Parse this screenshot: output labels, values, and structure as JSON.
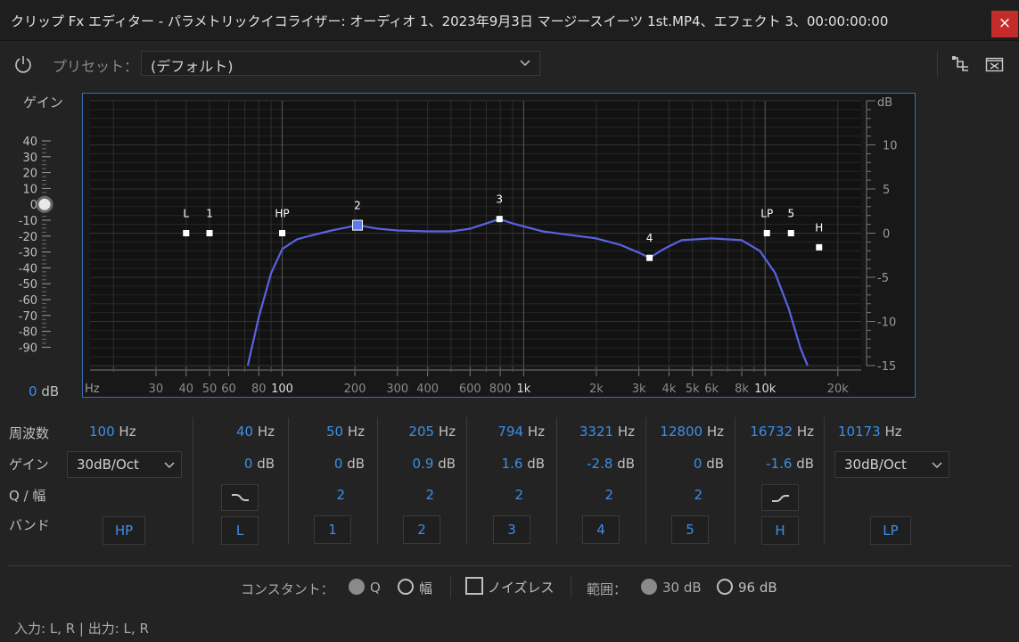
{
  "window": {
    "title": "クリップ Fx エディター - パラメトリックイコライザー: オーディオ 1、2023年9月3日 マージースイーツ 1st.MP4、エフェクト 3、00:00:00:00",
    "close_glyph": "×"
  },
  "toolbar": {
    "preset_label": "プリセット：",
    "preset_value": "(デフォルト)"
  },
  "gain_slider": {
    "label": "ゲイン",
    "ticks": [
      "40",
      "30",
      "20",
      "10",
      "0",
      "-10",
      "-20",
      "-30",
      "-40",
      "-50",
      "-60",
      "-70",
      "-80",
      "-90"
    ],
    "value": "0",
    "unit": "dB"
  },
  "chart_data": {
    "type": "line",
    "x_scale": "log",
    "xlim": [
      16,
      25000
    ],
    "ylim": [
      -15,
      15
    ],
    "x_unit_label": "Hz",
    "y_unit_label": "dB",
    "x_ticks": [
      "30",
      "40",
      "50",
      "60",
      "80",
      "100",
      "200",
      "300",
      "400",
      "600",
      "800",
      "1k",
      "2k",
      "3k",
      "4k",
      "5k",
      "6k",
      "8k",
      "10k",
      "20k"
    ],
    "x_tick_values": [
      30,
      40,
      50,
      60,
      80,
      100,
      200,
      300,
      400,
      600,
      800,
      1000,
      2000,
      3000,
      4000,
      5000,
      6000,
      8000,
      10000,
      20000
    ],
    "y_ticks": [
      "10",
      "5",
      "0",
      "-5",
      "-10",
      "-15"
    ],
    "y_tick_values": [
      10,
      5,
      0,
      -5,
      -10,
      -15
    ],
    "grid": true,
    "series": [
      {
        "color": "#5a63e0",
        "x": [
          72,
          80,
          90,
          100,
          115,
          130,
          160,
          205,
          250,
          300,
          400,
          500,
          600,
          700,
          794,
          900,
          1200,
          2000,
          2500,
          3000,
          3321,
          3800,
          4500,
          6000,
          8000,
          9500,
          11000,
          12500,
          14000,
          15000
        ],
        "y": [
          -15,
          -9.5,
          -4.5,
          -1.8,
          -0.7,
          -0.3,
          0.3,
          0.9,
          0.5,
          0.3,
          0.2,
          0.2,
          0.5,
          1.1,
          1.6,
          1.1,
          0.2,
          -0.6,
          -1.3,
          -2.2,
          -2.8,
          -1.8,
          -0.8,
          -0.6,
          -0.8,
          -2,
          -4.5,
          -8.5,
          -13,
          -15
        ]
      }
    ],
    "handles": [
      {
        "label": "L",
        "x": 40,
        "y": 0,
        "selected": false
      },
      {
        "label": "1",
        "x": 50,
        "y": 0,
        "selected": false
      },
      {
        "label": "HP",
        "x": 100,
        "y": 0,
        "selected": false
      },
      {
        "label": "2",
        "x": 205,
        "y": 0.9,
        "selected": true
      },
      {
        "label": "3",
        "x": 794,
        "y": 1.6,
        "selected": false
      },
      {
        "label": "4",
        "x": 3321,
        "y": -2.8,
        "selected": false
      },
      {
        "label": "LP",
        "x": 10173,
        "y": 0,
        "selected": false
      },
      {
        "label": "5",
        "x": 12800,
        "y": 0,
        "selected": false
      },
      {
        "label": "H",
        "x": 16732,
        "y": -1.6,
        "selected": false
      }
    ]
  },
  "bands": {
    "row_labels": {
      "frequency": "周波数",
      "gain": "ゲイン",
      "q": "Q / 幅",
      "band": "バンド"
    },
    "hz_unit": "Hz",
    "db_unit": "dB",
    "hp": {
      "freq": "100",
      "slope": "30dB/Oct",
      "button": "HP"
    },
    "l": {
      "freq": "40",
      "gain": "0",
      "button": "L"
    },
    "b1": {
      "freq": "50",
      "gain": "0",
      "q": "2",
      "button": "1"
    },
    "b2": {
      "freq": "205",
      "gain": "0.9",
      "q": "2",
      "button": "2"
    },
    "b3": {
      "freq": "794",
      "gain": "1.6",
      "q": "2",
      "button": "3"
    },
    "b4": {
      "freq": "3321",
      "gain": "-2.8",
      "q": "2",
      "button": "4"
    },
    "b5": {
      "freq": "12800",
      "gain": "0",
      "q": "2",
      "button": "5"
    },
    "h": {
      "freq": "16732",
      "gain": "-1.6",
      "button": "H"
    },
    "lp": {
      "freq": "10173",
      "slope": "30dB/Oct",
      "button": "LP"
    }
  },
  "footer": {
    "constant_label": "コンスタント：",
    "q_option": "Q",
    "width_option": "幅",
    "noiseless_label": "ノイズレス",
    "range_label": "範囲：",
    "range_30": "30 dB",
    "range_96": "96 dB",
    "io_text": "入力: L, R | 出力: L, R"
  },
  "colors": {
    "accent": "#3d8ee6",
    "curve": "#5a63e0",
    "close": "#c42b2b"
  }
}
